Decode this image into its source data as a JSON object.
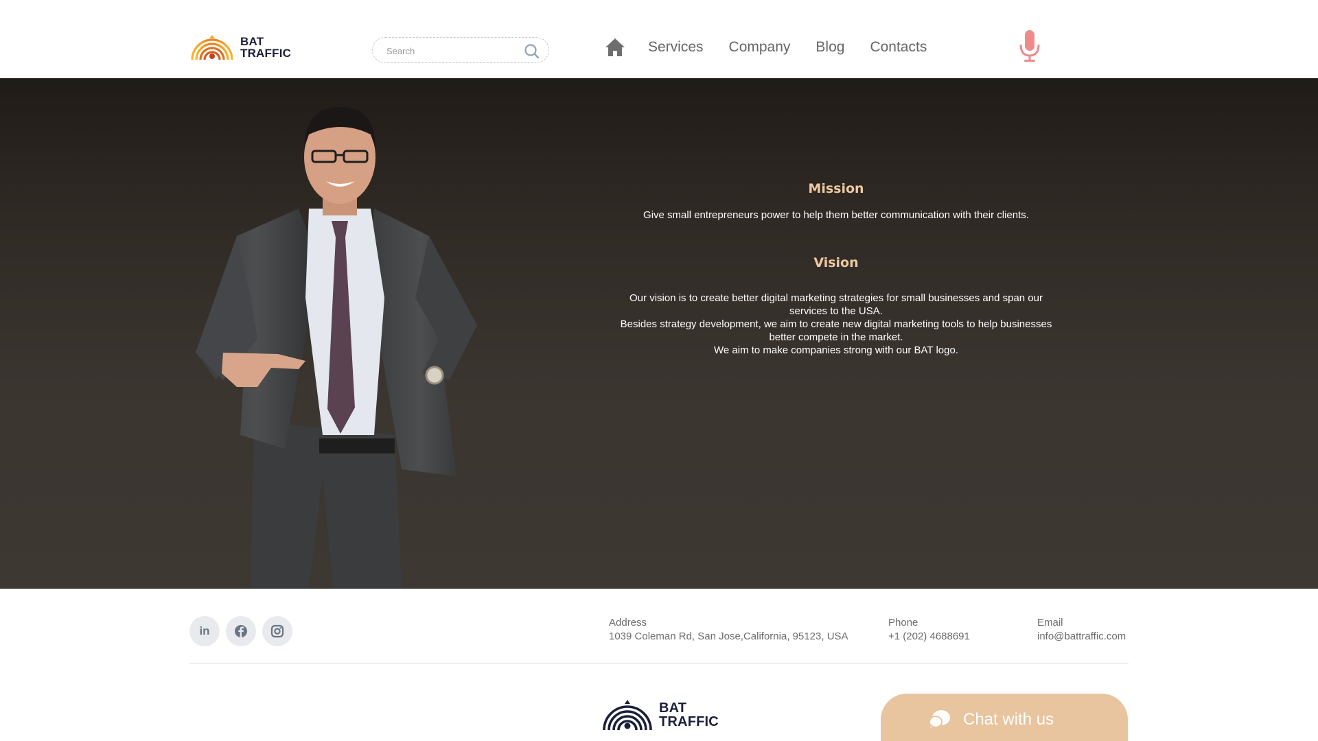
{
  "brand": {
    "line1": "BAT",
    "line2": "TRAFFIC"
  },
  "search": {
    "placeholder": "Search",
    "value": ""
  },
  "nav": {
    "home_icon": "home-icon",
    "items": [
      {
        "label": "Services"
      },
      {
        "label": "Company"
      },
      {
        "label": "Blog"
      },
      {
        "label": "Contacts"
      }
    ]
  },
  "mic_icon": "microphone-icon",
  "colors": {
    "accent": "#efc9a2",
    "chat_bg": "#e8c49f",
    "mic": "#f08a8a",
    "hero_bg": "#3b3530",
    "logo_dark": "#1c1f3a"
  },
  "mission": {
    "title": "Mission",
    "text": "Give small entrepreneurs power to help them better communication with their clients."
  },
  "vision": {
    "title": "Vision",
    "lines": [
      "Our vision is to create better digital marketing strategies for small businesses and span our services to the USA.",
      "Besides strategy development, we aim to create new digital marketing tools to help businesses better compete in the market.",
      "We aim to make companies strong with our BAT logo."
    ]
  },
  "footer": {
    "socials": [
      {
        "name": "linkedin-icon",
        "glyph": "in"
      },
      {
        "name": "facebook-icon"
      },
      {
        "name": "instagram-icon"
      }
    ],
    "address": {
      "label": "Address",
      "value": "1039 Coleman Rd, San Jose,California,  95123, USA"
    },
    "phone": {
      "label": "Phone",
      "value": "+1 (202) 4688691"
    },
    "email": {
      "label": "Email",
      "value": "info@battraffic.com"
    }
  },
  "chat": {
    "label": "Chat with us",
    "icon": "chat-bubble-icon"
  }
}
